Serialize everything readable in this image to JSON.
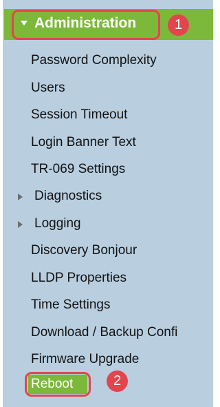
{
  "menu": {
    "section_label": "Administration",
    "items": [
      {
        "label": "Password Complexity"
      },
      {
        "label": "Users"
      },
      {
        "label": "Session Timeout"
      },
      {
        "label": "Login Banner Text"
      },
      {
        "label": "TR-069 Settings"
      },
      {
        "label": "Diagnostics"
      },
      {
        "label": "Logging"
      },
      {
        "label": "Discovery Bonjour"
      },
      {
        "label": "LLDP Properties"
      },
      {
        "label": "Time Settings"
      },
      {
        "label": "Download / Backup Confi"
      },
      {
        "label": "Firmware Upgrade"
      },
      {
        "label": "Reboot"
      }
    ]
  },
  "callouts": {
    "first": "1",
    "second": "2"
  },
  "colors": {
    "menu_background": "#b9cfe0",
    "active_green": "#7cb83a",
    "callout_red": "#e3454f"
  },
  "icons": {
    "section_expander": "caret-down-icon",
    "submenu_expander": "caret-right-icon"
  }
}
